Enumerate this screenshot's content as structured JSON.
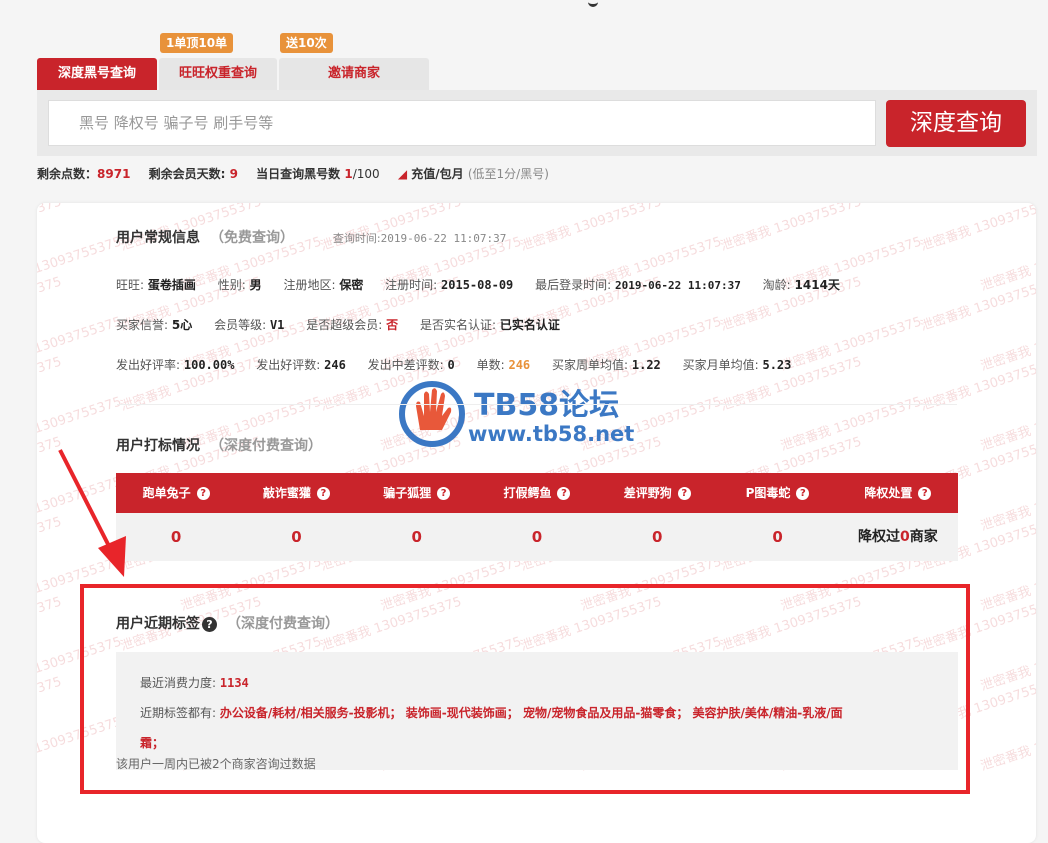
{
  "tabs": [
    {
      "label": "深度黑号查询",
      "badge": ""
    },
    {
      "label": "旺旺权重查询",
      "badge": "1单顶10单"
    },
    {
      "label": "邀请商家",
      "badge": "送10次"
    }
  ],
  "search": {
    "placeholder": "黑号 降权号 骗子号 刷手号等",
    "button": "深度查询"
  },
  "stats": {
    "points_label": "剩余点数：",
    "points": "8971",
    "days_label": "剩余会员天数:",
    "days": "9",
    "today_label": "当日查询黑号数",
    "today_used": "1",
    "today_total": "/100",
    "recharge_label": "充值/包月",
    "recharge_note": "(低至1分/黑号)"
  },
  "general": {
    "title": "用户常规信息",
    "subtitle": "（免费查询）",
    "time_label": "查询时间:",
    "time": "2019-06-22 11:07:37",
    "row1": [
      {
        "label": "旺旺:",
        "value": "蛋卷插画"
      },
      {
        "label": "性别:",
        "value": "男"
      },
      {
        "label": "注册地区:",
        "value": "保密"
      },
      {
        "label": "注册时间:",
        "value": "2015-08-09"
      },
      {
        "label": "最后登录时间:",
        "value": "2019-06-22 11:07:37"
      },
      {
        "label": "淘龄:",
        "value": "1414天"
      }
    ],
    "row2": [
      {
        "label": "买家信誉:",
        "value": "5心"
      },
      {
        "label": "会员等级:",
        "value": "V1"
      },
      {
        "label": "是否超级会员:",
        "value": "否"
      },
      {
        "label": "是否实名认证:",
        "value": "已实名认证"
      }
    ],
    "row3": [
      {
        "label": "发出好评率:",
        "value": "100.00%"
      },
      {
        "label": "发出好评数:",
        "value": "246"
      },
      {
        "label": "发出中差评数:",
        "value": "0"
      },
      {
        "label": "单数:",
        "value": "246"
      },
      {
        "label": "买家周单均值:",
        "value": "1.22"
      },
      {
        "label": "买家月单均值:",
        "value": "5.23"
      }
    ]
  },
  "marks": {
    "title": "用户打标情况",
    "subtitle": "（深度付费查询）",
    "headers": [
      "跑单兔子",
      "敲诈蜜獾",
      "骗子狐狸",
      "打假鳄鱼",
      "差评野狗",
      "P图毒蛇",
      "降权处置"
    ],
    "values": [
      "0",
      "0",
      "0",
      "0",
      "0",
      "0"
    ],
    "demote_prefix": "降权过",
    "demote_count": "0",
    "demote_suffix": "商家"
  },
  "tags": {
    "title": "用户近期标签",
    "subtitle": "（深度付费查询）",
    "spend_label": "最近消费力度:",
    "spend": "1134",
    "tags_label": "近期标签都有:",
    "tags_line1": "办公设备/耗材/相关服务-投影机；  装饰画-现代装饰画；  宠物/宠物食品及用品-猫零食；  美容护肤/美体/精油-乳液/面",
    "tags_line2": "霜；",
    "note": "该用户一周内已被2个商家咨询过数据"
  },
  "watermark": {
    "text": "泄密番我 13093755375",
    "logo_title": "TB58论坛",
    "logo_url": "www.tb58.net"
  },
  "colors": {
    "brand_red": "#c9242b",
    "orange": "#e8923a",
    "frame_red": "#e8252a"
  }
}
